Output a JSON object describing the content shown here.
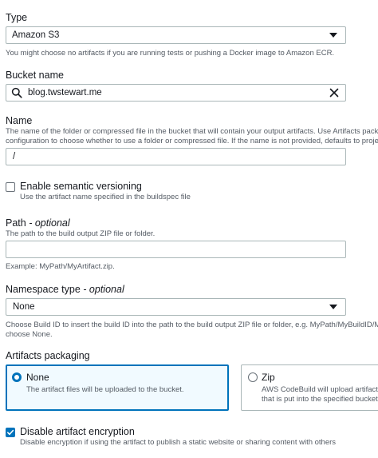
{
  "type_field": {
    "label": "Type",
    "value": "Amazon S3",
    "description": "You might choose no artifacts if you are running tests or pushing a Docker image to Amazon ECR."
  },
  "bucket_field": {
    "label": "Bucket name",
    "value": "blog.twstewart.me"
  },
  "name_field": {
    "label": "Name",
    "description_1": "The name of the folder or compressed file in the bucket that will contain your output artifacts. Use Artifacts packa",
    "description_2": "configuration to choose whether to use a folder or compressed file. If the name is not provided, defaults to projec",
    "value": "/"
  },
  "semantic_versioning": {
    "label": "Enable semantic versioning",
    "description": "Use the artifact name specified in the buildspec file",
    "checked": false
  },
  "path_field": {
    "label": "Path",
    "optional": "- optional",
    "description": "The path to the build output ZIP file or folder.",
    "value": "",
    "example": "Example: MyPath/MyArtifact.zip."
  },
  "namespace_field": {
    "label": "Namespace type",
    "optional": "- optional",
    "value": "None",
    "description_1": "Choose Build ID to insert the build ID into the path to the build output ZIP file or folder, e.g. MyPath/MyBuildID/M",
    "description_2": "choose None."
  },
  "packaging": {
    "label": "Artifacts packaging",
    "options": [
      {
        "title": "None",
        "description": "The artifact files will be uploaded to the bucket.",
        "selected": true
      },
      {
        "title": "Zip",
        "description_1": "AWS CodeBuild will upload artifact",
        "description_2": "that is put into the specified bucket",
        "selected": false
      }
    ]
  },
  "encryption": {
    "label": "Disable artifact encryption",
    "description": "Disable encryption if using the artifact to publish a static website or sharing content with others",
    "checked": true
  },
  "colors": {
    "accent": "#0073bb",
    "selected_tile_bg": "#f1faff",
    "border": "#aab7b8",
    "description_text": "#545b64"
  },
  "icons": [
    "search-icon",
    "clear-icon",
    "caret-down-icon",
    "check-icon"
  ]
}
